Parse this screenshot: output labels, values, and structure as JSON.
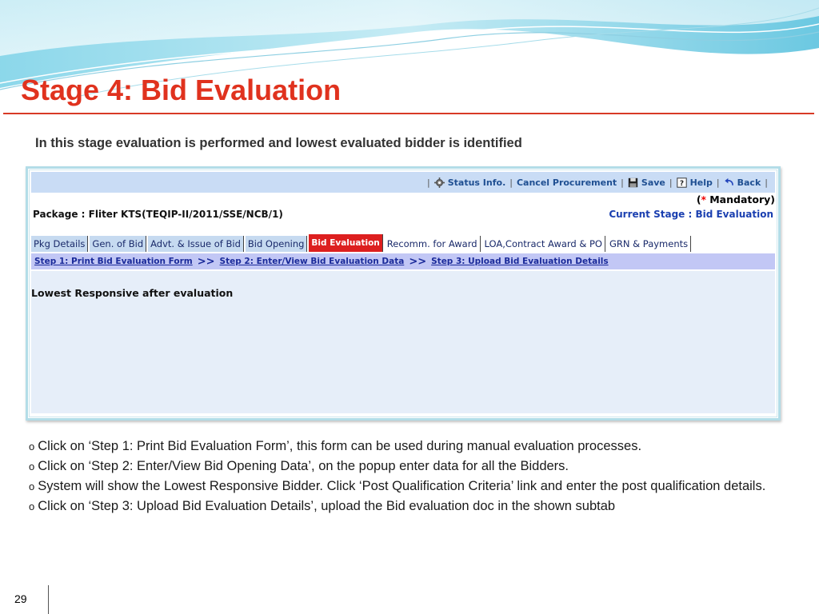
{
  "slide": {
    "title": "Stage 4: Bid Evaluation",
    "subtitle": "In this stage evaluation is performed and lowest evaluated bidder is identified",
    "page_number": "29",
    "title_color": "#e0321e"
  },
  "app": {
    "toolbar": {
      "status_info": "Status Info.",
      "cancel_procurement": "Cancel Procurement",
      "save": "Save",
      "help": "Help",
      "back": "Back"
    },
    "mandatory": {
      "open": "(",
      "star": "*",
      "label": " Mandatory)"
    },
    "package_label": "Package : Fliter KTS(TEQIP-II/2011/SSE/NCB/1)",
    "current_stage": "Current Stage : Bid Evaluation",
    "tabs": [
      {
        "label": "Pkg Details"
      },
      {
        "label": "Gen. of Bid"
      },
      {
        "label": "Advt. & Issue of Bid"
      },
      {
        "label": "Bid Opening"
      },
      {
        "label": "Bid Evaluation"
      },
      {
        "label": "Recomm. for Award"
      },
      {
        "label": "LOA,Contract Award & PO"
      },
      {
        "label": "GRN & Payments"
      }
    ],
    "steps": {
      "step1": "Step 1: Print Bid Evaluation Form",
      "step2": "Step 2: Enter/View Bid Evaluation Data",
      "step3": "Step 3: Upload Bid Evaluation Details",
      "separator": ">>"
    },
    "section_heading": "Lowest Responsive after evaluation"
  },
  "bullets": [
    "Click on ‘Step 1: Print Bid Evaluation Form’, this form can be used during manual evaluation processes.",
    "Click on ‘Step 2: Enter/View Bid Opening Data’, on the popup enter data for all the Bidders.",
    "System will show the Lowest Responsive Bidder. Click ‘Post Qualification Criteria’ link and enter the post qualification details.",
    "Click on ‘Step 3: Upload Bid Evaluation Details’, upload the Bid evaluation doc in the shown subtab"
  ],
  "bullet_mark": "o"
}
